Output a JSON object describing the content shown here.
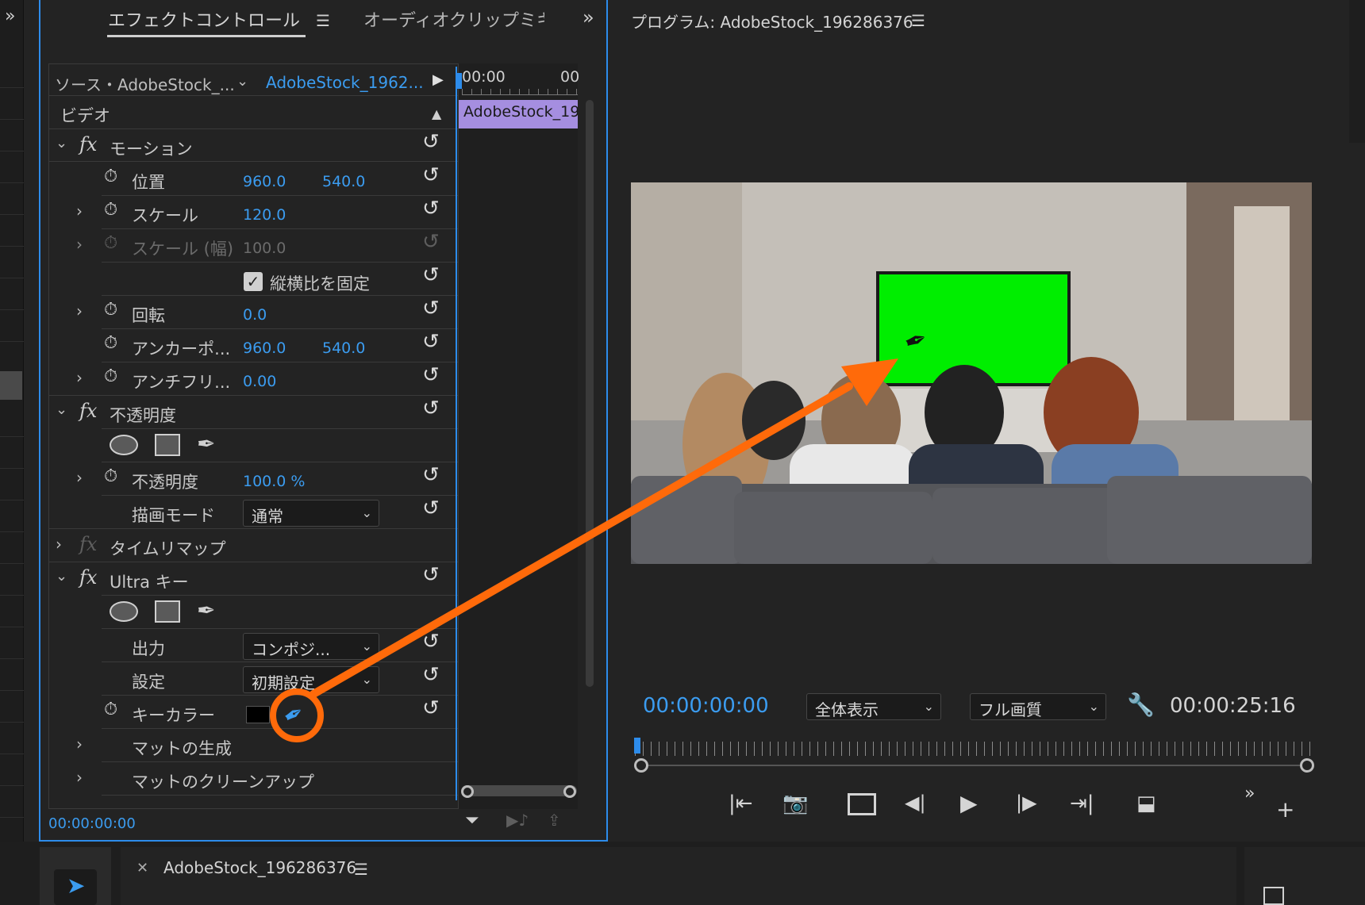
{
  "effect_controls": {
    "tab_title": "エフェクトコントロール",
    "second_tab": "オーディオクリップミキ",
    "source_label": "ソース・AdobeStock_...",
    "clip_name": "AdobeStock_1962...",
    "timeline_start": "00:00",
    "timeline_end": "00",
    "timeline_clip": "AdobeStock_19",
    "section_video": "ビデオ",
    "motion": {
      "title": "モーション",
      "position_label": "位置",
      "position_x": "960.0",
      "position_y": "540.0",
      "scale_label": "スケール",
      "scale_value": "120.0",
      "scale_width_label": "スケール (幅)",
      "scale_width_value": "100.0",
      "uniform_scale_label": "縦横比を固定",
      "rotation_label": "回転",
      "rotation_value": "0.0",
      "anchor_label": "アンカーポ...",
      "anchor_x": "960.0",
      "anchor_y": "540.0",
      "antiflicker_label": "アンチフリ...",
      "antiflicker_value": "0.00"
    },
    "opacity": {
      "title": "不透明度",
      "opacity_label": "不透明度",
      "opacity_value": "100.0 %",
      "blend_label": "描画モード",
      "blend_value": "通常"
    },
    "time_remap": {
      "title": "タイムリマップ"
    },
    "ultra_key": {
      "title": "Ultra キー",
      "output_label": "出力",
      "output_value": "コンポジ...",
      "setting_label": "設定",
      "setting_value": "初期設定",
      "key_color_label": "キーカラー",
      "key_color": "#000000",
      "matte_generation": "マットの生成",
      "matte_cleanup": "マットのクリーンアップ"
    },
    "footer_timecode": "00:00:00:00"
  },
  "program_monitor": {
    "title": "プログラム: AdobeStock_196286376",
    "timecode": "00:00:00:00",
    "zoom": "全体表示",
    "quality": "フル画質",
    "duration": "00:00:25:16"
  },
  "timeline": {
    "sequence_tab": "AdobeStock_196286376"
  },
  "colors": {
    "accent_blue": "#3b9cf0",
    "panel_border": "#2d8ceb",
    "annotation": "#ff6a0a",
    "green_screen": "#00ee00",
    "clip_purple": "#a58ee0"
  }
}
